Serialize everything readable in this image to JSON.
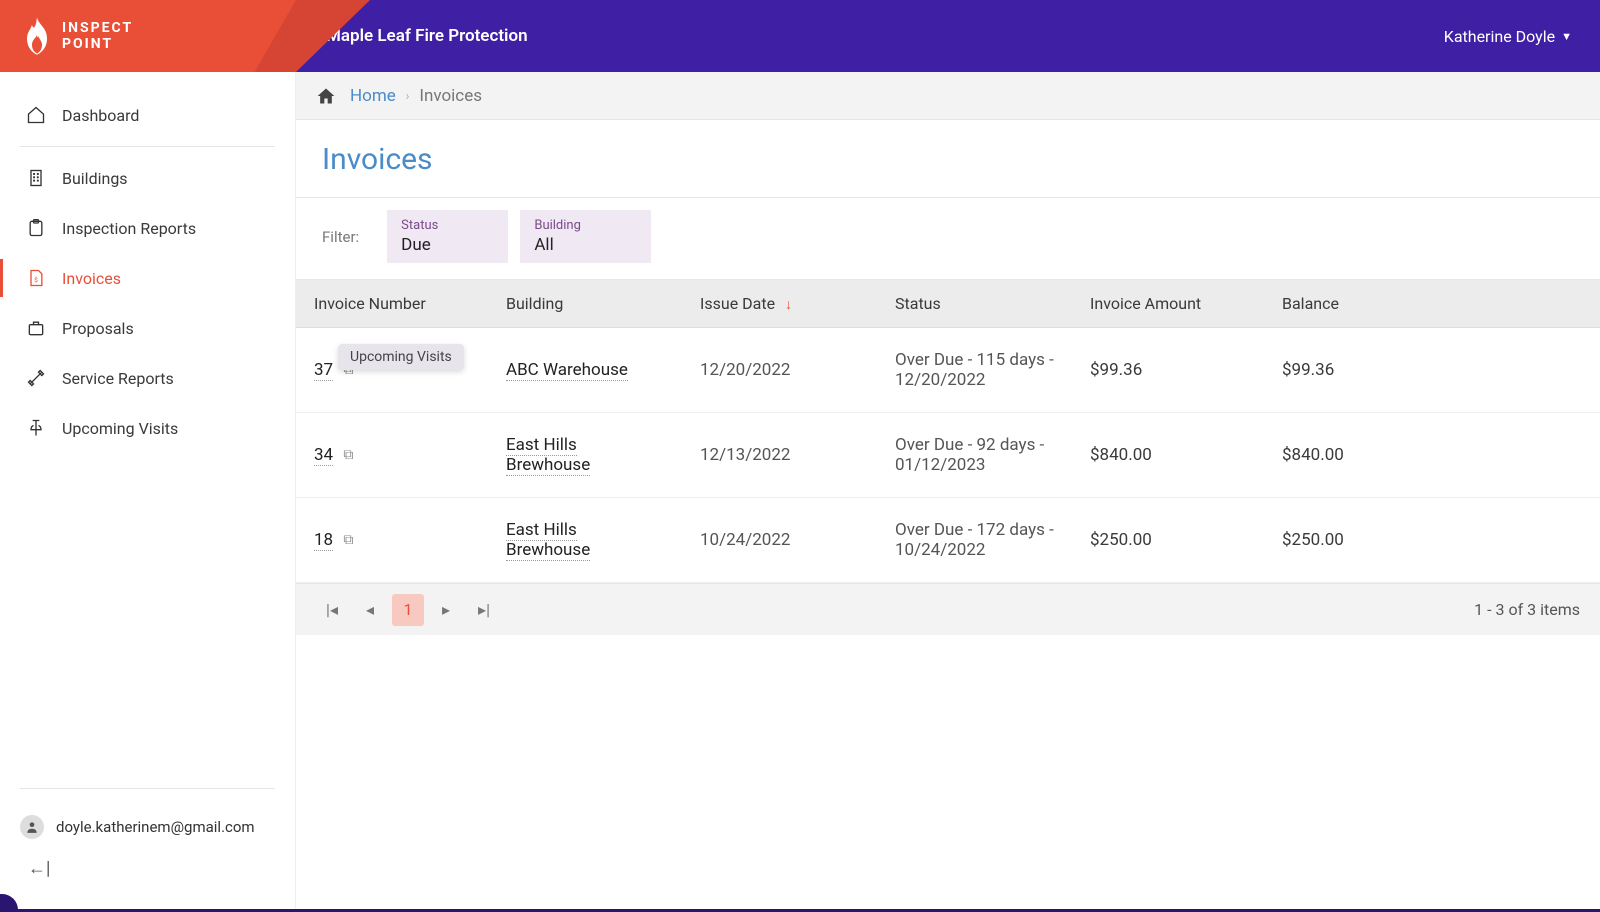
{
  "brand": {
    "line1": "INSPECT",
    "line2": "POINT"
  },
  "topbar": {
    "org": "Maple Leaf Fire Protection",
    "user": "Katherine Doyle"
  },
  "sidebar": {
    "items": [
      {
        "label": "Dashboard"
      },
      {
        "label": "Buildings"
      },
      {
        "label": "Inspection Reports"
      },
      {
        "label": "Invoices"
      },
      {
        "label": "Proposals"
      },
      {
        "label": "Service Reports"
      },
      {
        "label": "Upcoming Visits"
      }
    ],
    "user_email": "doyle.katherinem@gmail.com"
  },
  "breadcrumb": {
    "home": "Home",
    "current": "Invoices"
  },
  "page": {
    "title": "Invoices"
  },
  "filters": {
    "label": "Filter:",
    "status_label": "Status",
    "status_value": "Due",
    "building_label": "Building",
    "building_value": "All"
  },
  "table": {
    "headers": {
      "invoice_number": "Invoice Number",
      "building": "Building",
      "issue_date": "Issue Date",
      "status": "Status",
      "invoice_amount": "Invoice Amount",
      "balance": "Balance"
    },
    "rows": [
      {
        "invoice_number": "37",
        "building": "ABC Warehouse",
        "issue_date": "12/20/2022",
        "status": "Over Due - 115 days - 12/20/2022",
        "invoice_amount": "$99.36",
        "balance": "$99.36"
      },
      {
        "invoice_number": "34",
        "building": "East Hills Brewhouse",
        "issue_date": "12/13/2022",
        "status": "Over Due - 92 days - 01/12/2023",
        "invoice_amount": "$840.00",
        "balance": "$840.00"
      },
      {
        "invoice_number": "18",
        "building": "East Hills Brewhouse",
        "issue_date": "10/24/2022",
        "status": "Over Due - 172 days - 10/24/2022",
        "invoice_amount": "$250.00",
        "balance": "$250.00"
      }
    ]
  },
  "tooltip": {
    "text": "Upcoming Visits"
  },
  "pagination": {
    "current": "1",
    "info": "1 - 3 of 3 items"
  }
}
